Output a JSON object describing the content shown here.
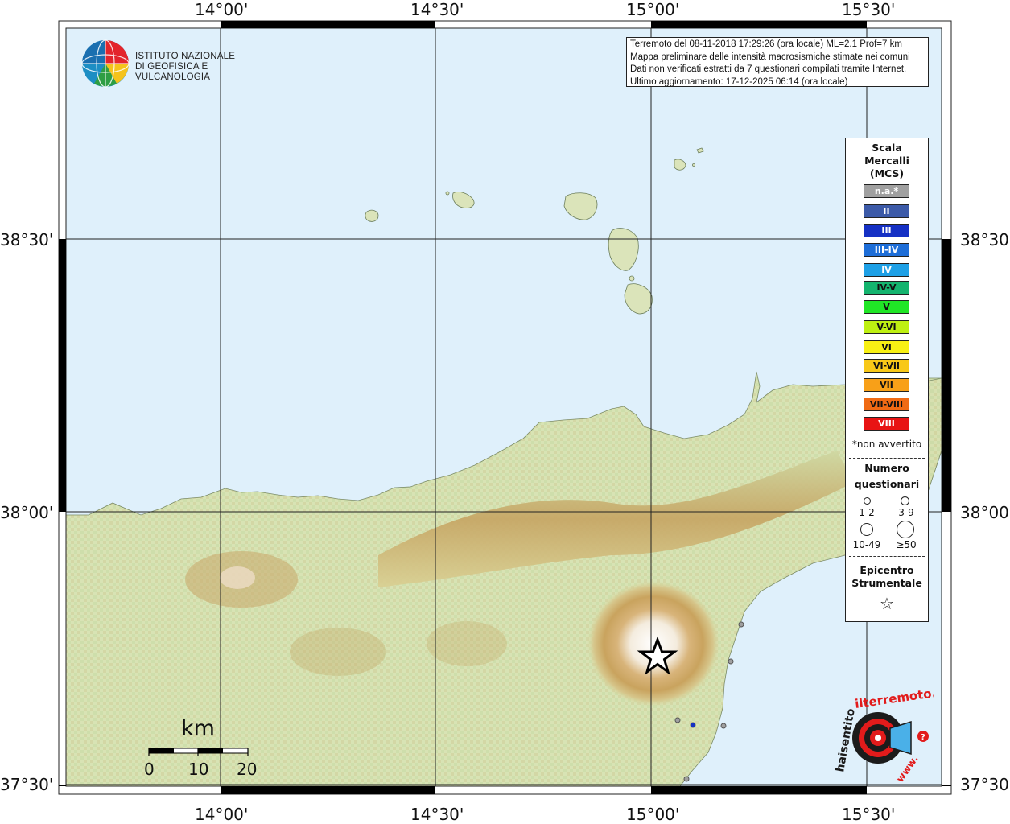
{
  "info": {
    "line1": "Terremoto del 08-11-2018 17:29:26 (ora locale) ML=2.1 Prof=7 km",
    "line2": "Mappa preliminare delle intensità macrosismiche stimate nei comuni",
    "line3": "Dati non verificati estratti da 7 questionari compilati tramite Internet.",
    "line4": "Ultimo aggiornamento: 17-12-2025 06:14 (ora locale)"
  },
  "institute": {
    "line1": "ISTITUTO NAZIONALE",
    "line2": "DI GEOFISICA E VULCANOLOGIA"
  },
  "axes": {
    "lon_top": [
      "14°00'",
      "14°30'",
      "15°00'",
      "15°30'"
    ],
    "lon_bottom": [
      "14°00'",
      "14°30'",
      "15°00'",
      "15°30'"
    ],
    "lat_left": [
      "38°30'",
      "38°00'",
      "37°30'"
    ],
    "lat_right": [
      "38°30'",
      "38°00'",
      "37°30'"
    ]
  },
  "legend": {
    "title1": "Scala",
    "title2": "Mercalli",
    "title3": "(MCS)",
    "scale": [
      {
        "label": "n.a.*",
        "color": "#a0a0a0",
        "text": "#ffffff"
      },
      {
        "label": "II",
        "color": "#3c5aa8",
        "text": "#ffffff"
      },
      {
        "label": "III",
        "color": "#1530c4",
        "text": "#ffffff"
      },
      {
        "label": "III-IV",
        "color": "#1e6ed8",
        "text": "#ffffff"
      },
      {
        "label": "IV",
        "color": "#1ea0e6",
        "text": "#ffffff"
      },
      {
        "label": "IV-V",
        "color": "#14b46e",
        "text": "#111111"
      },
      {
        "label": "V",
        "color": "#20e626",
        "text": "#111111"
      },
      {
        "label": "V-VI",
        "color": "#bef012",
        "text": "#111111"
      },
      {
        "label": "VI",
        "color": "#f8f014",
        "text": "#111111"
      },
      {
        "label": "VI-VII",
        "color": "#f8c818",
        "text": "#111111"
      },
      {
        "label": "VII",
        "color": "#f8a018",
        "text": "#111111"
      },
      {
        "label": "VII-VIII",
        "color": "#f06a14",
        "text": "#111111"
      },
      {
        "label": "VIII",
        "color": "#e81414",
        "text": "#ffffff"
      }
    ],
    "not_felt_note": "*non avvertito",
    "count_title1": "Numero",
    "count_title2": "questionari",
    "count_labels": [
      "1-2",
      "3-9",
      "10-49",
      "≥50"
    ],
    "epi_title1": "Epicentro",
    "epi_title2": "Strumentale",
    "epi_symbol": "☆"
  },
  "scalebar": {
    "unit": "km",
    "ticks": [
      "0",
      "10",
      "20"
    ]
  },
  "hsl_logo": {
    "text_main": "haisentito",
    "text_accent": "ilterremoto.it",
    "text_www": "www."
  },
  "map_features": {
    "epicenter_icon": "star-icon",
    "observation_points": [
      {
        "intensity": "n.a.*",
        "color": "#a0a0a0"
      },
      {
        "intensity": "n.a.*",
        "color": "#a0a0a0"
      },
      {
        "intensity": "n.a.*",
        "color": "#a0a0a0"
      },
      {
        "intensity": "III",
        "color": "#1530c4"
      },
      {
        "intensity": "n.a.*",
        "color": "#a0a0a0"
      },
      {
        "intensity": "n.a.*",
        "color": "#a0a0a0"
      }
    ],
    "sea_color": "#dff0fb",
    "land_color": "#d8e3b4"
  }
}
